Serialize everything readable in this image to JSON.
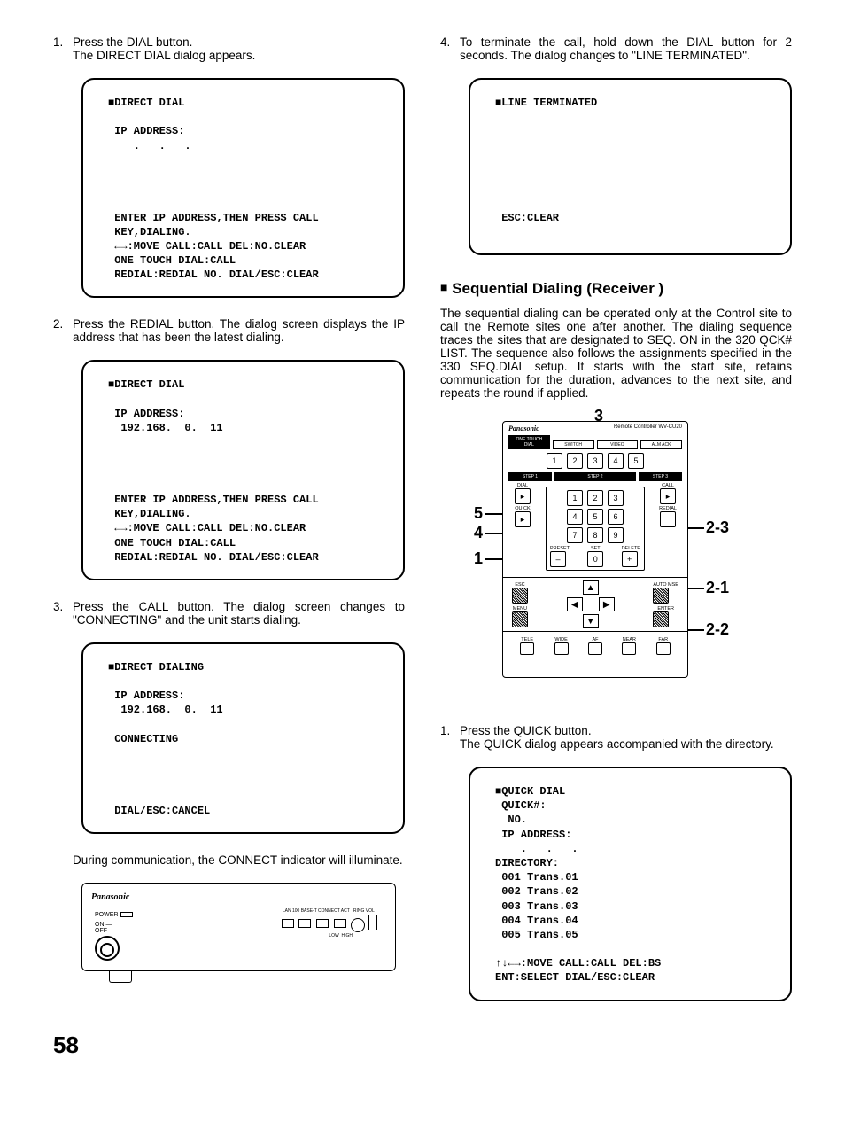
{
  "left": {
    "step1_num": "1.",
    "step1_l1": "Press the DIAL button.",
    "step1_l2": "The DIRECT DIAL dialog appears.",
    "dialogA": "■DIRECT DIAL\n\n IP ADDRESS:\n    .   .   .\n\n\n\n\n ENTER IP ADDRESS,THEN PRESS CALL\n KEY,DIALING.\n ←→:MOVE CALL:CALL DEL:NO.CLEAR\n ONE TOUCH DIAL:CALL\n REDIAL:REDIAL NO. DIAL/ESC:CLEAR",
    "step2_num": "2.",
    "step2_txt": "Press the REDIAL button. The dialog screen displays the IP address that has been the latest dialing.",
    "dialogB": "■DIRECT DIAL\n\n IP ADDRESS:\n  192.168.  0.  11\n\n\n\n\n ENTER IP ADDRESS,THEN PRESS CALL\n KEY,DIALING.\n ←→:MOVE CALL:CALL DEL:NO.CLEAR\n ONE TOUCH DIAL:CALL\n REDIAL:REDIAL NO. DIAL/ESC:CLEAR",
    "step3_num": "3.",
    "step3_txt": "Press the CALL button. The dialog screen changes to \"CONNECTING\" and the unit starts dialing.",
    "dialogC": "■DIRECT DIALING\n\n IP ADDRESS:\n  192.168.  0.  11\n\n CONNECTING\n\n\n\n\n DIAL/ESC:CANCEL",
    "note": "During communication, the CONNECT indicator will illuminate.",
    "panel_brand": "Panasonic",
    "panel_power": "POWER",
    "panel_on": "ON —",
    "panel_off": "OFF —",
    "panel_led_row": "LAN  100  BASE-T  CONNECT  ACT",
    "panel_ringvol": "RING VOL",
    "panel_low": "LOW",
    "panel_high": "HIGH"
  },
  "right": {
    "step4_num": "4.",
    "step4_txt": "To terminate the call, hold down the DIAL button for 2 seconds. The dialog changes to \"LINE TERMINATED\".",
    "dialogD": "■LINE TERMINATED\n\n\n\n\n\n\n\n ESC:CLEAR",
    "heading": "Sequential Dialing (Receiver )",
    "para": "The sequential dialing can be operated only at the Control site to call the Remote sites one after another. The dialing sequence traces the sites that are designated to SEQ. ON in the 320 QCK# LIST. The sequence also follows the assignments specified in the 330 SEQ.DIAL setup. It starts with the start site, retains communication for the duration, advances to the next site, and repeats the round if applied.",
    "remote_brand": "Panasonic",
    "remote_model": "Remote Controller WV-CU20",
    "remote_tabs": [
      "ONE TOUCH DIAL",
      "SWITCH",
      "VIDEO",
      "ALM ACK"
    ],
    "remote_step1": "STEP 1",
    "remote_step2": "STEP 2",
    "remote_step3": "STEP 3",
    "remote_dial": "DIAL",
    "remote_call": "CALL",
    "remote_quick": "QUICK",
    "remote_redial": "REDIAL",
    "remote_preset": "PRESET",
    "remote_set": "SET",
    "remote_delete": "DELETE",
    "remote_esc": "ESC",
    "remote_menu": "MENU",
    "remote_enter": "ENTER",
    "remote_automse": "AUTO MSE",
    "remote_bottom": [
      "TELE",
      "WIDE",
      "AF",
      "NEAR",
      "FAR"
    ],
    "callout_1": "1",
    "callout_3": "3",
    "callout_4": "4",
    "callout_5": "5",
    "callout_21": "2-1",
    "callout_22": "2-2",
    "callout_23": "2-3",
    "seq_step1_num": "1.",
    "seq_step1_l1": "Press the QUICK button.",
    "seq_step1_l2": "The QUICK dialog appears accompanied with the directory.",
    "dialogE": "■QUICK DIAL\n QUICK#:\n  NO.\n IP ADDRESS:\n    .   .   .\nDIRECTORY:\n 001 Trans.01\n 002 Trans.02\n 003 Trans.03\n 004 Trans.04\n 005 Trans.05\n\n↑↓←→:MOVE CALL:CALL DEL:BS\nENT:SELECT DIAL/ESC:CLEAR"
  },
  "page_number": "58"
}
